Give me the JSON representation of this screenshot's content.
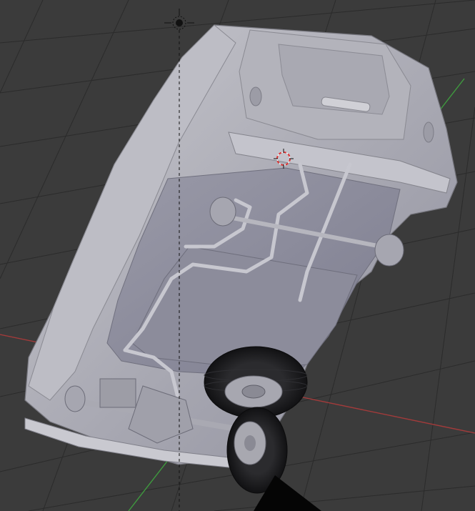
{
  "viewport": {
    "background": "#3b3b3b",
    "grid_color": "#2c2c2c",
    "x_axis_color": "#a23b3b",
    "y_axis_color": "#3f9a3f"
  },
  "model": {
    "body_color": "#b9b9c0",
    "shadow_color": "#8c8c99",
    "tire_color": "#1d1d1f"
  },
  "icons": {
    "lamp": "sun-lamp-icon",
    "cursor": "3d-cursor-icon",
    "camera": "camera-icon"
  }
}
